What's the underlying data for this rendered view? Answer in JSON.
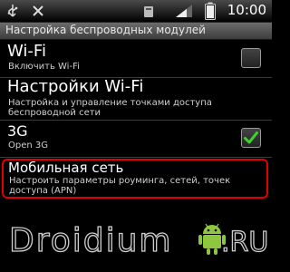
{
  "status_bar": {
    "time": "10:00",
    "icons": [
      "usb-icon",
      "no-sim-icon",
      "notification-icon",
      "signal-icon",
      "battery-icon"
    ]
  },
  "title_bar": {
    "title": "Настройка беспроводных модулей"
  },
  "settings": [
    {
      "title": "Wi-Fi",
      "subtitle": "Включить Wi-Fi",
      "checkbox": true,
      "checked": false
    },
    {
      "title": "Настройки Wi-Fi",
      "subtitle_lines": [
        "Настройка и управление точками доступа",
        "беспроводной сети"
      ],
      "checkbox": false
    },
    {
      "title": "3G",
      "subtitle": "Open 3G",
      "checkbox": true,
      "checked": true
    },
    {
      "title": "Мобильная сеть",
      "subtitle_lines": [
        "Настроить параметры роуминга, сетей, точек",
        "доступа (APN)"
      ],
      "checkbox": false,
      "highlighted": true
    }
  ],
  "watermark": {
    "left": "Droidium",
    "right": ".RU"
  },
  "colors": {
    "highlight": "#e00000",
    "checkmark": "#3fcf2f"
  }
}
